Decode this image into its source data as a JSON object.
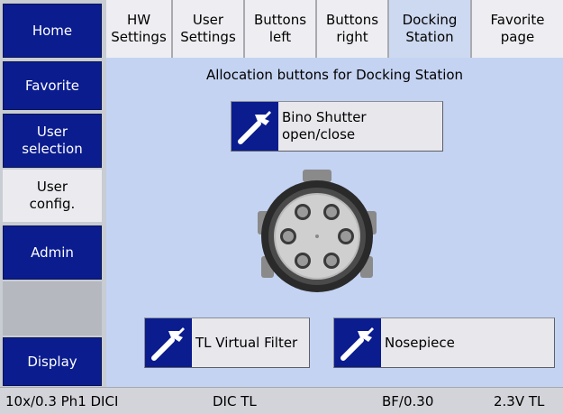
{
  "sidebar": {
    "items": [
      {
        "label": "Home"
      },
      {
        "label": "Favorite"
      },
      {
        "label": "User\nselection"
      },
      {
        "label": "User\nconfig."
      },
      {
        "label": "Admin"
      },
      {
        "label": "Display"
      }
    ]
  },
  "tabs": [
    {
      "label": "HW\nSettings"
    },
    {
      "label": "User\nSettings"
    },
    {
      "label": "Buttons\nleft"
    },
    {
      "label": "Buttons\nright"
    },
    {
      "label": "Docking\nStation"
    },
    {
      "label": "Favorite\npage"
    }
  ],
  "main": {
    "title": "Allocation buttons for Docking Station",
    "buttons": [
      {
        "label": "Bino Shutter\nopen/close",
        "icon": "wrench-icon"
      },
      {
        "label": "TL Virtual Filter",
        "icon": "wrench-icon"
      },
      {
        "label": "Nosepiece",
        "icon": "wrench-icon"
      }
    ],
    "image": "docking-station-dial"
  },
  "status": {
    "objective": "10x/0.3 Ph1 DICI",
    "contrast": "DIC TL",
    "filter": "BF/0.30",
    "lamp": "2.3V TL"
  },
  "colors": {
    "nav_blue": "#0a1c8e",
    "content_bg": "#c4d3f2",
    "active_tab": "#cdd9f0",
    "button_bg": "#e7e7ec"
  }
}
